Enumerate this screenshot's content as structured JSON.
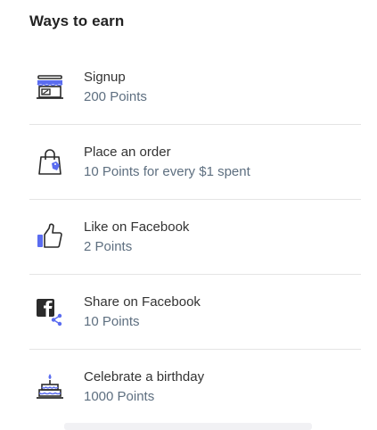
{
  "header": {
    "title": "Ways to earn"
  },
  "colors": {
    "accent": "#5a6cf0",
    "icon_stroke": "#2b2b2b",
    "subtext": "#5e6f80"
  },
  "items": [
    {
      "icon": "storefront-icon",
      "name": "Signup",
      "points": "200 Points"
    },
    {
      "icon": "shopping-bag-icon",
      "name": "Place an order",
      "points": "10 Points for every $1 spent"
    },
    {
      "icon": "thumbs-up-icon",
      "name": "Like on Facebook",
      "points": "2 Points"
    },
    {
      "icon": "facebook-share-icon",
      "name": "Share on Facebook",
      "points": "10 Points"
    },
    {
      "icon": "birthday-cake-icon",
      "name": "Celebrate a birthday",
      "points": "1000 Points"
    }
  ]
}
